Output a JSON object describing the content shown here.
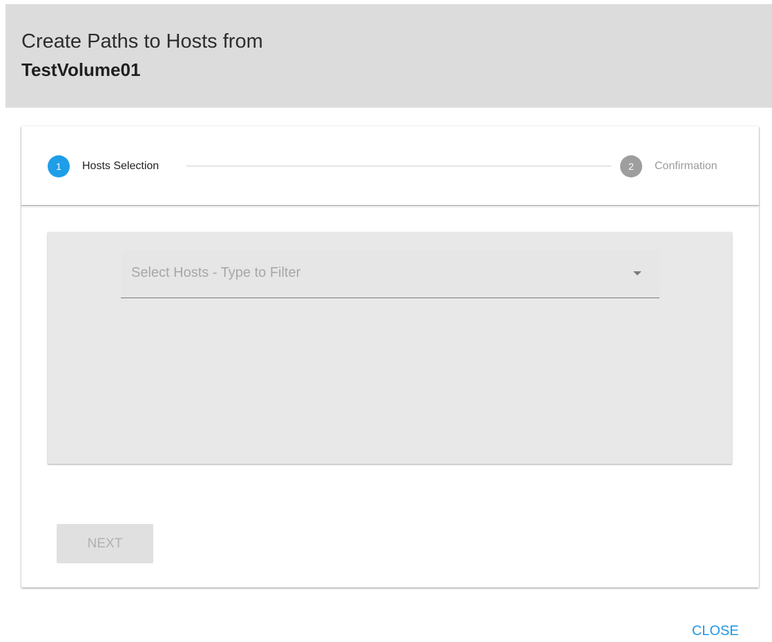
{
  "dialog": {
    "title": "Create Paths to Hosts from",
    "subtitle": "TestVolume01"
  },
  "stepper": {
    "steps": [
      {
        "number": "1",
        "label": "Hosts Selection",
        "state": "active"
      },
      {
        "number": "2",
        "label": "Confirmation",
        "state": "inactive"
      }
    ]
  },
  "hosts_select": {
    "placeholder": "Select Hosts - Type to Filter",
    "icon": "chevron-down-icon"
  },
  "actions": {
    "next_label": "NEXT",
    "close_label": "CLOSE"
  },
  "colors": {
    "accent": "#1e9ee8",
    "header_bg": "#dcdcdc",
    "panel_bg": "#e8e8e8",
    "link": "#2196e8"
  }
}
